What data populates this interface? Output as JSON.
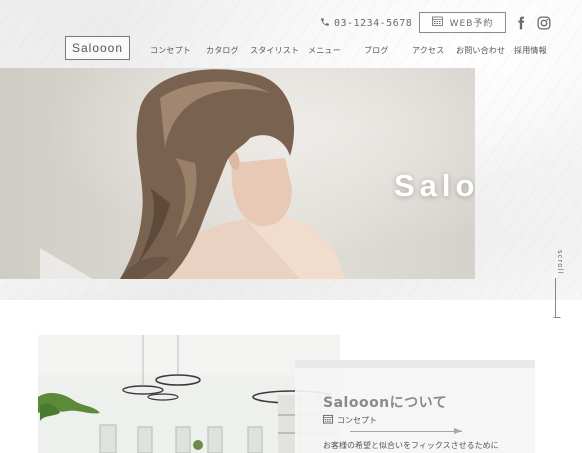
{
  "header": {
    "phone": "03-1234-5678",
    "reserve_label": "WEB予約",
    "logo": "Salooon"
  },
  "nav": {
    "items": [
      {
        "label": "コンセプト"
      },
      {
        "label": "カタログ"
      },
      {
        "label": "スタイリスト"
      },
      {
        "label": "メニュー"
      },
      {
        "label": "ブログ"
      },
      {
        "label": "アクセス"
      },
      {
        "label": "お問い合わせ"
      },
      {
        "label": "採用情報"
      }
    ]
  },
  "hero": {
    "title": "Salooon",
    "scroll_label": "scroll"
  },
  "about": {
    "title": "Salooonについて",
    "subtitle": "コンセプト",
    "text": "お客様の希望と似合いをフィックスさせるために"
  },
  "colors": {
    "text": "#555555",
    "accent_gray": "#8a8a8a",
    "hero_title": "#ffffff"
  },
  "icons": {
    "phone": "phone-icon",
    "calendar": "calendar-icon",
    "facebook": "facebook-icon",
    "instagram": "instagram-icon",
    "concept": "calendar-icon"
  }
}
